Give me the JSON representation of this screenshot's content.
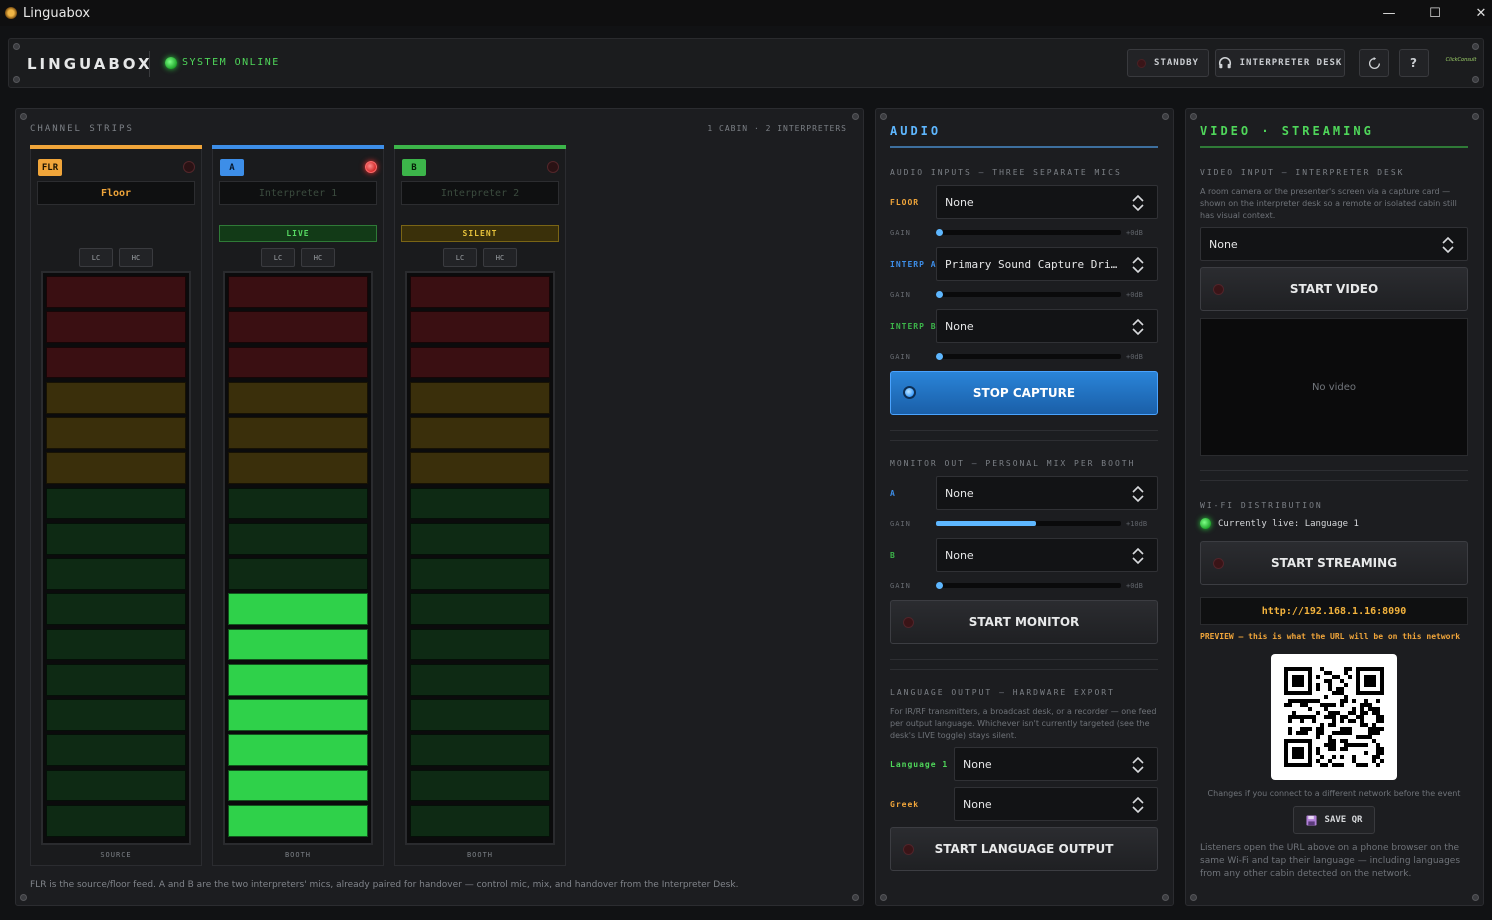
{
  "window": {
    "title": "Linguabox",
    "minimize": "—",
    "maximize": "☐",
    "close": "✕"
  },
  "header": {
    "brand": "LINGUABOX",
    "status": "SYSTEM ONLINE",
    "standby_label": "STANDBY",
    "interpreter_desk_label": "INTERPRETER DESK",
    "help_label": "?",
    "logo_text": "ClickConsult"
  },
  "channel_strips": {
    "title": "CHANNEL STRIPS",
    "summary": "1 CABIN · 2 INTERPRETERS",
    "strips": [
      {
        "badge": "FLR",
        "name": "Floor",
        "state": "",
        "filters": [
          "LC",
          "HC"
        ],
        "footer": "SOURCE",
        "color": "#f0a53a",
        "recording": false,
        "level_segments_lit": 0
      },
      {
        "badge": "A",
        "name": "Interpreter 1",
        "state": "LIVE",
        "filters": [
          "LC",
          "HC"
        ],
        "footer": "BOOTH",
        "color": "#3d8ee8",
        "recording": true,
        "level_segments_lit": 7
      },
      {
        "badge": "B",
        "name": "Interpreter 2",
        "state": "SILENT",
        "filters": [
          "LC",
          "HC"
        ],
        "footer": "BOOTH",
        "color": "#3cb54a",
        "recording": false,
        "level_segments_lit": 0
      }
    ],
    "footnote": "FLR is the source/floor feed. A and B are the two interpreters' mics, already paired for handover — control mic, mix, and handover from the Interpreter Desk."
  },
  "audio": {
    "title": "AUDIO",
    "inputs_label": "AUDIO INPUTS — THREE SEPARATE MICS",
    "inputs": [
      {
        "label": "FLOOR",
        "device": "None",
        "gain_label": "GAIN",
        "gain_db": "+0dB",
        "gain": 0.0
      },
      {
        "label": "INTERP A",
        "device": "Primary Sound Capture Driver",
        "gain_label": "GAIN",
        "gain_db": "+0dB",
        "gain": 0.0
      },
      {
        "label": "INTERP B",
        "device": "None",
        "gain_label": "GAIN",
        "gain_db": "+0dB",
        "gain": 0.0
      }
    ],
    "stop_capture_label": "STOP CAPTURE",
    "monitor_label": "MONITOR OUT — PERSONAL MIX PER BOOTH",
    "monitors": [
      {
        "label": "A",
        "device": "None",
        "gain_label": "GAIN",
        "gain_db": "+10dB",
        "gain": 0.54
      },
      {
        "label": "B",
        "device": "None",
        "gain_label": "GAIN",
        "gain_db": "+0dB",
        "gain": 0.0
      }
    ],
    "start_monitor_label": "START MONITOR",
    "language_output_label": "LANGUAGE OUTPUT — HARDWARE EXPORT",
    "language_output_note": "For IR/RF transmitters, a broadcast desk, or a recorder — one feed per output language. Whichever isn't currently targeted (see the desk's LIVE toggle) stays silent.",
    "languages": [
      {
        "label": "Language 1",
        "device": "None"
      },
      {
        "label": "Greek",
        "device": "None"
      }
    ],
    "start_language_output_label": "START LANGUAGE OUTPUT"
  },
  "video": {
    "title": "VIDEO · STREAMING",
    "input_label": "VIDEO INPUT — INTERPRETER DESK",
    "input_note": "A room camera or the presenter's screen via a capture card — shown on the interpreter desk so a remote or isolated cabin still has visual context.",
    "device": "None",
    "start_video_label": "START VIDEO",
    "no_video": "No video",
    "wifi_label": "WI-FI DISTRIBUTION",
    "live_status": "Currently live: Language 1",
    "start_streaming_label": "START STREAMING",
    "url": "http://192.168.1.16:8090",
    "preview_note": "PREVIEW — this is what the URL will be on this network",
    "network_note": "Changes if you connect to a different network before the event",
    "save_qr_label": "SAVE QR",
    "listener_note": "Listeners open the URL above on a phone browser on the same Wi-Fi and tap their language — including languages from any other cabin detected on the network."
  },
  "colors": {
    "floor": "#f0a53a",
    "interp_a": "#3d8ee8",
    "interp_b": "#3cb54a",
    "online": "#4fd65a",
    "url": "#f3b33d"
  }
}
